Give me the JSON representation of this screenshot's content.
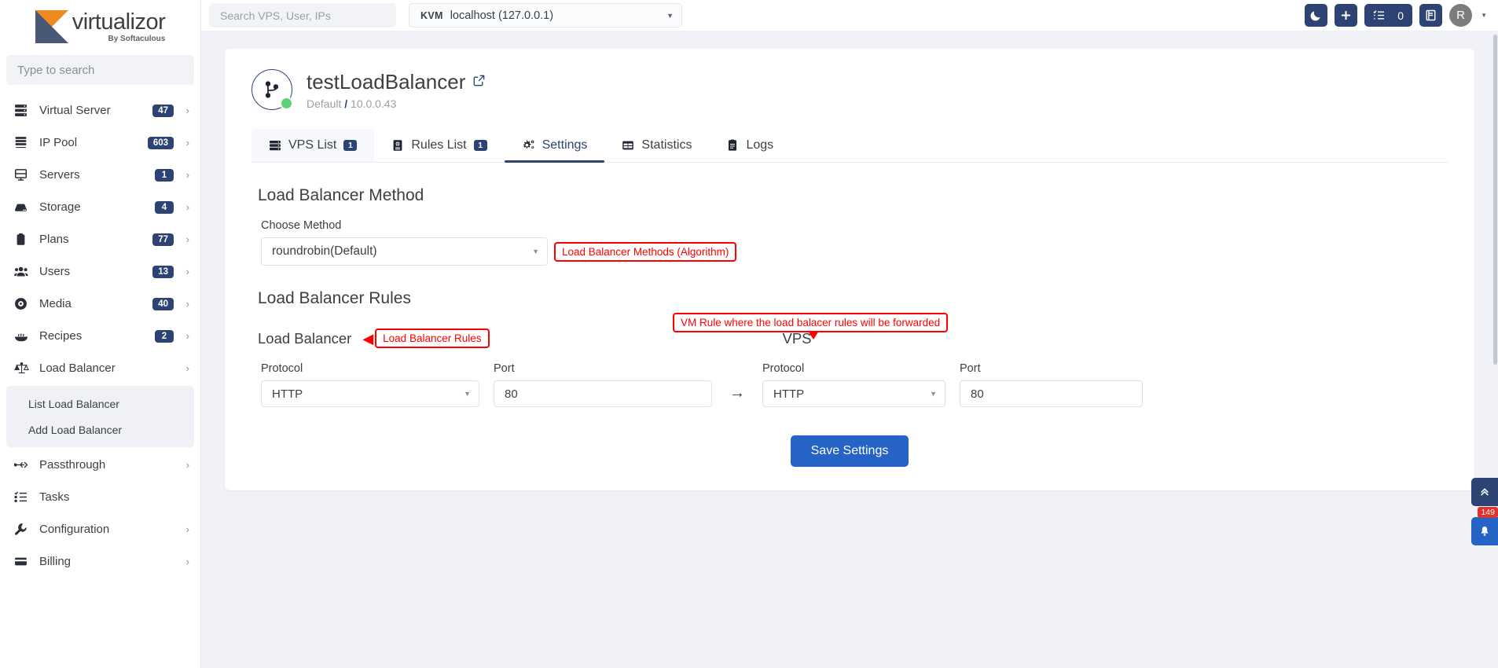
{
  "brand": {
    "name": "virtualizor",
    "tagline": "By Softaculous"
  },
  "sidebar": {
    "search_placeholder": "Type to search",
    "items": [
      {
        "label": "Virtual Server",
        "badge": "47",
        "icon": "server-stack-icon",
        "chevron": "›"
      },
      {
        "label": "IP Pool",
        "badge": "603",
        "icon": "ip-pool-icon",
        "chevron": "›"
      },
      {
        "label": "Servers",
        "badge": "1",
        "icon": "desktop-icon",
        "chevron": "›"
      },
      {
        "label": "Storage",
        "badge": "4",
        "icon": "storage-icon",
        "chevron": "›"
      },
      {
        "label": "Plans",
        "badge": "77",
        "icon": "clipboard-icon",
        "chevron": "›"
      },
      {
        "label": "Users",
        "badge": "13",
        "icon": "users-icon",
        "chevron": "›"
      },
      {
        "label": "Media",
        "badge": "40",
        "icon": "disc-icon",
        "chevron": "›"
      },
      {
        "label": "Recipes",
        "badge": "2",
        "icon": "recipe-bowl-icon",
        "chevron": "›"
      },
      {
        "label": "Load Balancer",
        "badge": "",
        "icon": "scales-icon",
        "chevron": "›"
      }
    ],
    "submenu": [
      {
        "label": "List Load Balancer"
      },
      {
        "label": "Add Load Balancer"
      }
    ],
    "items_after": [
      {
        "label": "Passthrough",
        "badge": "",
        "icon": "usb-icon",
        "chevron": "›"
      },
      {
        "label": "Tasks",
        "badge": "",
        "icon": "tasks-icon",
        "chevron": ""
      },
      {
        "label": "Configuration",
        "badge": "",
        "icon": "wrench-icon",
        "chevron": "›"
      },
      {
        "label": "Billing",
        "badge": "",
        "icon": "billing-icon",
        "chevron": "›"
      }
    ]
  },
  "topbar": {
    "search_placeholder": "Search VPS, User, IPs",
    "kvm_tag": "KVM",
    "kvm_host": "localhost (127.0.0.1)",
    "dark_mode_icon": "moon-icon",
    "add_icon": "plus-icon",
    "tasks_icon": "task-list-icon",
    "tasks_count": "0",
    "docs_icon": "book-icon",
    "avatar_letter": "R"
  },
  "page": {
    "title": "testLoadBalancer",
    "external_link_icon": "external-link-icon",
    "breadcrumb_group": "Default",
    "breadcrumb_sep": "/",
    "breadcrumb_ip": "10.0.0.43",
    "status": "online"
  },
  "tabs": [
    {
      "label": "VPS List",
      "badge": "1",
      "icon": "server-list-icon",
      "active": false
    },
    {
      "label": "Rules List",
      "badge": "1",
      "icon": "rules-book-icon",
      "active": false
    },
    {
      "label": "Settings",
      "badge": "",
      "icon": "gear-icon",
      "active": true
    },
    {
      "label": "Statistics",
      "badge": "",
      "icon": "grid-table-icon",
      "active": false
    },
    {
      "label": "Logs",
      "badge": "",
      "icon": "logs-icon",
      "active": false
    }
  ],
  "method_section": {
    "heading": "Load Balancer Method",
    "field_label": "Choose Method",
    "selected_value": "roundrobin(Default)",
    "annotation": "Load Balancer Methods (Algorithm)"
  },
  "rules_section": {
    "heading": "Load Balancer Rules",
    "annotation_vm": "VM Rule where the load balacer rules will be forwarded",
    "lb_column_title": "Load Balancer",
    "lb_annotation": "Load Balancer Rules",
    "vps_column_title": "VPS",
    "protocol_label": "Protocol",
    "port_label": "Port",
    "lb_protocol": "HTTP",
    "lb_port": "80",
    "flow_arrow": "→",
    "vps_protocol": "HTTP",
    "vps_port": "80",
    "save_label": "Save Settings"
  },
  "widgets": {
    "scroll_top_icon": "chevron-double-up-icon",
    "bell_icon": "bell-icon",
    "bell_count": "149"
  },
  "colors": {
    "brand_navy": "#2d4373",
    "brand_orange": "#f08a1e",
    "accent_blue": "#2563c7",
    "annotation_red": "#ff0000",
    "status_green": "#5ed07a"
  }
}
